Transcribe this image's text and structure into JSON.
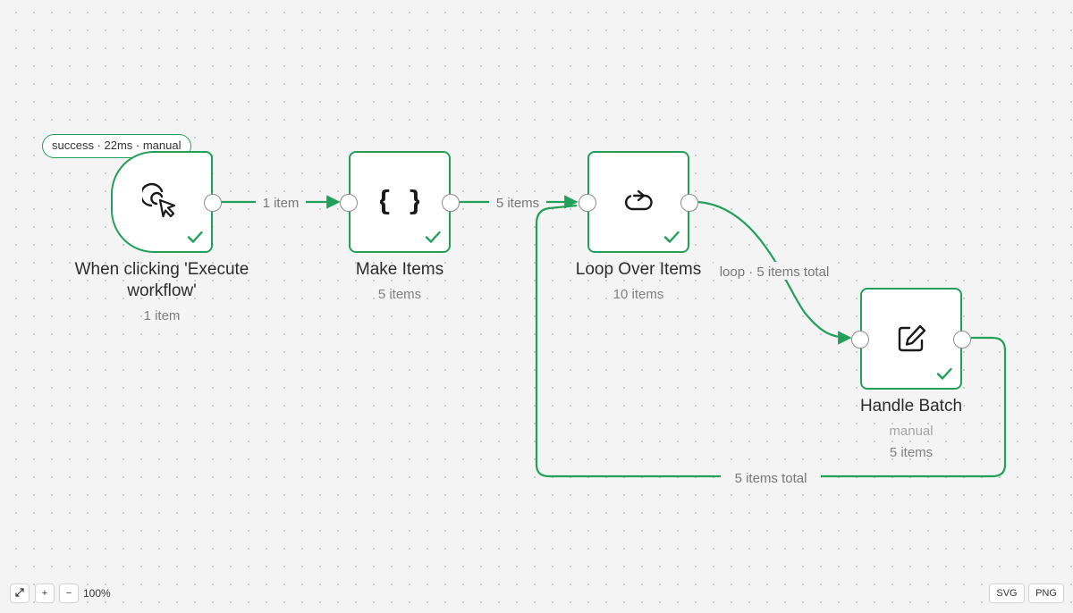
{
  "execution": {
    "status_badge": "success · 22ms · manual"
  },
  "nodes": [
    {
      "id": "trigger",
      "title_line1": "When clicking 'Execute",
      "title_line2": "workflow'",
      "items": "1 item",
      "icon": "cursor-click-icon",
      "status": "success"
    },
    {
      "id": "make-items",
      "title": "Make Items",
      "items": "5 items",
      "icon": "code-braces-icon",
      "status": "success"
    },
    {
      "id": "loop",
      "title": "Loop Over Items",
      "items": "10 items",
      "icon": "loop-icon",
      "status": "success"
    },
    {
      "id": "handle-batch",
      "title": "Handle Batch",
      "mode": "manual",
      "items": "5 items",
      "icon": "edit-icon",
      "status": "success"
    }
  ],
  "edges": [
    {
      "from": "trigger",
      "to": "make-items",
      "label": "1 item"
    },
    {
      "from": "make-items",
      "to": "loop",
      "label": "5 items"
    },
    {
      "from": "loop",
      "to": "handle-batch",
      "label": "loop · 5 items total"
    },
    {
      "from": "handle-batch",
      "to": "loop",
      "label": "5 items total"
    }
  ],
  "toolbar": {
    "fit_icon": "fit-view-icon",
    "zoom_in": "+",
    "zoom_out": "−",
    "zoom_level": "100%",
    "export_svg": "SVG",
    "export_png": "PNG"
  },
  "colors": {
    "success": "#22a05a",
    "background": "#f4f4f4",
    "node_bg": "#ffffff"
  }
}
